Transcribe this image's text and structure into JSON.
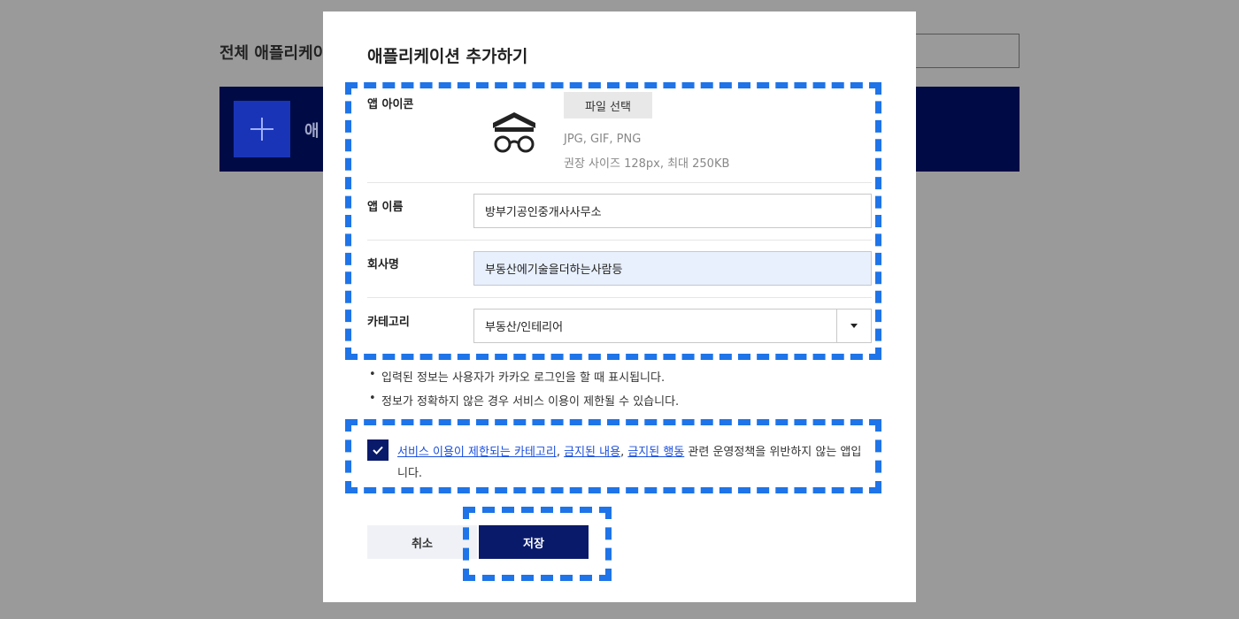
{
  "background": {
    "title": "전체 애플리케이",
    "banner_text": "애"
  },
  "modal": {
    "title": "애플리케이션 추가하기",
    "icon_row": {
      "label": "앱 아이콘",
      "file_button": "파일 선택",
      "hint_formats": "JPG, GIF, PNG",
      "hint_size": "권장 사이즈 128px, 최대 250KB"
    },
    "name_row": {
      "label": "앱 이름",
      "value": "방부기공인중개사사무소"
    },
    "company_row": {
      "label": "회사명",
      "value": "부동산에기술을더하는사람등"
    },
    "category_row": {
      "label": "카테고리",
      "value": "부동산/인테리어"
    },
    "notes": [
      "입력된 정보는 사용자가 카카오 로그인을 할 때 표시됩니다.",
      "정보가 정확하지 않은 경우 서비스 이용이 제한될 수 있습니다."
    ],
    "agree": {
      "link1": "서비스 이용이 제한되는 카테고리",
      "link2": "금지된 내용",
      "link3": "금지된 행동",
      "sep": ",",
      "suffix": "관련 운영정책을 위반하지 않는 앱입니다."
    },
    "buttons": {
      "cancel": "취소",
      "save": "저장"
    }
  },
  "colors": {
    "accent_navy": "#0a1a6b",
    "highlight_blue": "#1e74e8",
    "link_blue": "#1c4fdb"
  }
}
